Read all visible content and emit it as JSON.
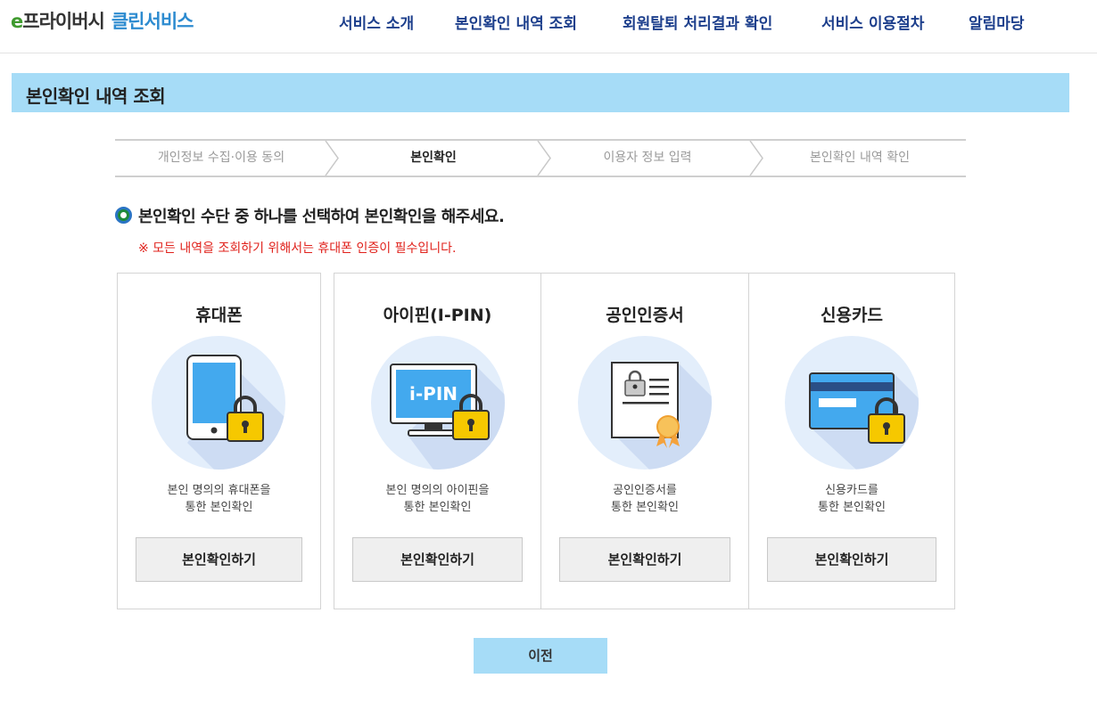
{
  "header": {
    "logo": {
      "prefix": "e",
      "main": "프라이버시",
      "accent": "클린서비스"
    },
    "nav": [
      {
        "label": "서비스 소개"
      },
      {
        "label": "본인확인 내역 조회"
      },
      {
        "label": "회원탈퇴 처리결과 확인"
      },
      {
        "label": "서비스 이용절차"
      },
      {
        "label": "알림마당"
      }
    ]
  },
  "page": {
    "title": "본인확인 내역 조회"
  },
  "steps": [
    {
      "label": "개인정보 수집·이용 동의",
      "active": false
    },
    {
      "label": "본인확인",
      "active": true
    },
    {
      "label": "이용자 정보 입력",
      "active": false
    },
    {
      "label": "본인확인 내역 확인",
      "active": false
    }
  ],
  "instruction": "본인확인 수단 중 하나를 선택하여 본인확인을 해주세요.",
  "notice": "※ 모든 내역을 조회하기 위해서는 휴대폰 인증이 필수입니다.",
  "methods": [
    {
      "title": "휴대폰",
      "icon": "phone-lock-icon",
      "desc_line1": "본인 명의의 휴대폰을",
      "desc_line2": "통한 본인확인",
      "button": "본인확인하기"
    },
    {
      "title": "아이핀(I-PIN)",
      "icon": "ipin-monitor-lock-icon",
      "icon_text": "i-PIN",
      "desc_line1": "본인 명의의 아이핀을",
      "desc_line2": "통한 본인확인",
      "button": "본인확인하기"
    },
    {
      "title": "공인인증서",
      "icon": "certificate-icon",
      "desc_line1": "공인인증서를",
      "desc_line2": "통한 본인확인",
      "button": "본인확인하기"
    },
    {
      "title": "신용카드",
      "icon": "credit-card-lock-icon",
      "desc_line1": "신용카드를",
      "desc_line2": "통한 본인확인",
      "button": "본인확인하기"
    }
  ],
  "prev_button": "이전",
  "colors": {
    "nav_text": "#1d3f8c",
    "title_bar": "#a6dcf7",
    "notice_red": "#e0211b",
    "icon_circle": "#e3eefb",
    "lock_yellow": "#f6c800"
  }
}
